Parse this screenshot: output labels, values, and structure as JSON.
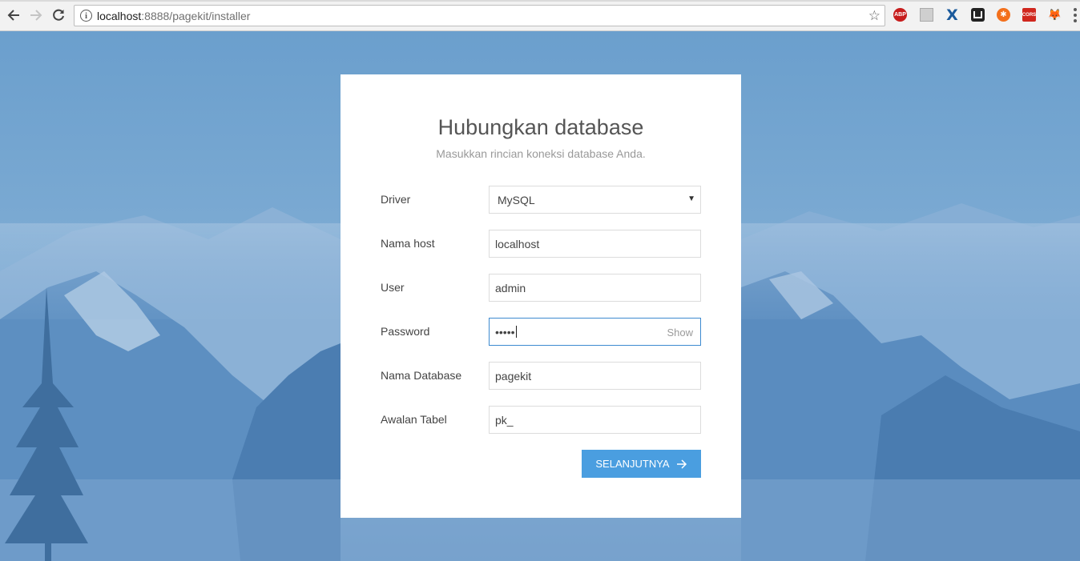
{
  "browser": {
    "url_host": "localhost",
    "url_rest": ":8888/pagekit/installer",
    "extensions": [
      "abp-icon",
      "document-icon",
      "x-extension-icon",
      "pocket-icon",
      "orange-extension-icon",
      "cors-icon",
      "fox-extension-icon"
    ],
    "ext_labels": {
      "abp": "ABP",
      "cors": "CORS"
    }
  },
  "form": {
    "title": "Hubungkan database",
    "subtitle": "Masukkan rincian koneksi database Anda.",
    "fields": [
      {
        "label": "Driver",
        "value": "MySQL"
      },
      {
        "label": "Nama host",
        "value": "localhost"
      },
      {
        "label": "User",
        "value": "admin"
      },
      {
        "label": "Password",
        "value": "•••••",
        "toggle": "Show"
      },
      {
        "label": "Nama Database",
        "value": "pagekit"
      },
      {
        "label": "Awalan Tabel",
        "value": "pk_"
      }
    ],
    "submit_label": "SELANJUTNYA"
  },
  "colors": {
    "accent": "#4a9ee0",
    "focus_border": "#3d8ad0",
    "background_sky": "#7aa9d2"
  }
}
